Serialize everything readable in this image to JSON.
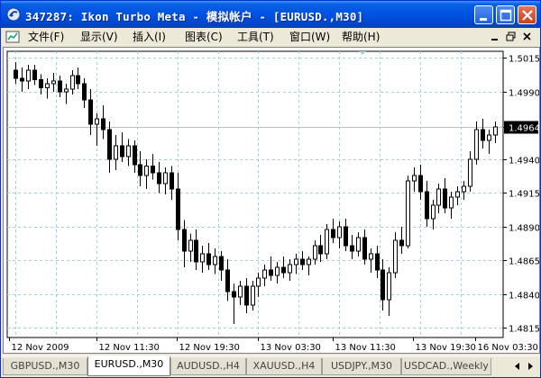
{
  "window": {
    "title": "347287: Ikon Turbo Meta - 模拟帐户 - [EURUSD.,M30]"
  },
  "menu": {
    "items": [
      {
        "name": "menu-file",
        "label": "文件(F)"
      },
      {
        "name": "menu-view",
        "label": "显示(V)"
      },
      {
        "name": "menu-insert",
        "label": "插入(I)"
      },
      {
        "name": "menu-charts",
        "label": "图表(C)"
      },
      {
        "name": "menu-tools",
        "label": "工具(T)"
      },
      {
        "name": "menu-window",
        "label": "窗口(W)"
      },
      {
        "name": "menu-help",
        "label": "帮助(H)"
      }
    ]
  },
  "chart_data": {
    "type": "candlestick",
    "symbol": "EURUSD.",
    "timeframe": "M30",
    "ylim": [
      1.4808,
      1.502
    ],
    "yticks": [
      "1.5015",
      "1.4990",
      "1.4964",
      "1.4940",
      "1.4915",
      "1.4890",
      "1.4865",
      "1.4840",
      "1.4815"
    ],
    "current_price": "1.4964",
    "xticks": [
      "12 Nov 2009",
      "12 Nov 11:30",
      "12 Nov 19:30",
      "13 Nov 03:30",
      "13 Nov 11:30",
      "13 Nov 19:30",
      "16 Nov 03:30"
    ],
    "grid": true,
    "grid_style": "dashed",
    "grid_color": "#9ed3e0",
    "candles": [
      [
        1.5006,
        1.5012,
        1.4996,
        1.5
      ],
      [
        1.5,
        1.5008,
        1.499,
        1.4998
      ],
      [
        1.4998,
        1.501,
        1.4992,
        1.5006
      ],
      [
        1.5006,
        1.501,
        1.4995,
        1.4999
      ],
      [
        1.4999,
        1.5003,
        1.4988,
        1.4993
      ],
      [
        1.4993,
        1.5,
        1.4985,
        1.4996
      ],
      [
        1.4996,
        1.5004,
        1.499,
        1.4998
      ],
      [
        1.4998,
        1.5002,
        1.4986,
        1.499
      ],
      [
        1.499,
        1.4996,
        1.4981,
        1.4992
      ],
      [
        1.4992,
        1.5006,
        1.4988,
        1.5002
      ],
      [
        1.5002,
        1.5008,
        1.4992,
        1.4996
      ],
      [
        1.4996,
        1.5,
        1.4978,
        1.4984
      ],
      [
        1.4984,
        1.4992,
        1.4958,
        1.4966
      ],
      [
        1.4966,
        1.4974,
        1.495,
        1.497
      ],
      [
        1.497,
        1.498,
        1.4955,
        1.4962
      ],
      [
        1.4962,
        1.4968,
        1.493,
        1.494
      ],
      [
        1.494,
        1.4958,
        1.4932,
        1.495
      ],
      [
        1.495,
        1.496,
        1.4938,
        1.4942
      ],
      [
        1.4942,
        1.4955,
        1.4935,
        1.495
      ],
      [
        1.495,
        1.4954,
        1.493,
        1.4936
      ],
      [
        1.4936,
        1.4946,
        1.492,
        1.4928
      ],
      [
        1.4928,
        1.494,
        1.4918,
        1.4935
      ],
      [
        1.4935,
        1.4944,
        1.4925,
        1.493
      ],
      [
        1.493,
        1.4938,
        1.4915,
        1.4922
      ],
      [
        1.4922,
        1.4934,
        1.4914,
        1.493
      ],
      [
        1.493,
        1.4935,
        1.491,
        1.4918
      ],
      [
        1.4918,
        1.493,
        1.488,
        1.4888
      ],
      [
        1.4888,
        1.4895,
        1.486,
        1.4872
      ],
      [
        1.4872,
        1.4885,
        1.4864,
        1.488
      ],
      [
        1.488,
        1.4888,
        1.4858,
        1.4864
      ],
      [
        1.4864,
        1.4876,
        1.4856,
        1.487
      ],
      [
        1.487,
        1.4878,
        1.4858,
        1.4862
      ],
      [
        1.4862,
        1.4874,
        1.4855,
        1.4868
      ],
      [
        1.4868,
        1.4872,
        1.485,
        1.4858
      ],
      [
        1.4858,
        1.4866,
        1.4835,
        1.4842
      ],
      [
        1.4842,
        1.4848,
        1.4818,
        1.4838
      ],
      [
        1.4838,
        1.485,
        1.4832,
        1.4846
      ],
      [
        1.4846,
        1.4852,
        1.4826,
        1.4832
      ],
      [
        1.4832,
        1.485,
        1.4828,
        1.4846
      ],
      [
        1.4846,
        1.4856,
        1.4838,
        1.4852
      ],
      [
        1.4852,
        1.4862,
        1.4846,
        1.4858
      ],
      [
        1.4858,
        1.4868,
        1.485,
        1.4854
      ],
      [
        1.4854,
        1.4864,
        1.4848,
        1.486
      ],
      [
        1.486,
        1.4868,
        1.4852,
        1.4856
      ],
      [
        1.4856,
        1.4866,
        1.485,
        1.4862
      ],
      [
        1.4862,
        1.487,
        1.4855,
        1.4866
      ],
      [
        1.4866,
        1.4872,
        1.4858,
        1.4862
      ],
      [
        1.4862,
        1.4868,
        1.4854,
        1.4866
      ],
      [
        1.4866,
        1.488,
        1.4862,
        1.4876
      ],
      [
        1.4876,
        1.4884,
        1.4864,
        1.487
      ],
      [
        1.487,
        1.4892,
        1.4866,
        1.4888
      ],
      [
        1.4888,
        1.4896,
        1.4878,
        1.4882
      ],
      [
        1.4882,
        1.4894,
        1.4874,
        1.489
      ],
      [
        1.489,
        1.4896,
        1.4872,
        1.4876
      ],
      [
        1.4876,
        1.4884,
        1.4866,
        1.4872
      ],
      [
        1.4872,
        1.4886,
        1.4868,
        1.4882
      ],
      [
        1.4882,
        1.4888,
        1.4862,
        1.4866
      ],
      [
        1.4866,
        1.4874,
        1.4856,
        1.487
      ],
      [
        1.487,
        1.4876,
        1.4852,
        1.4858
      ],
      [
        1.4858,
        1.4866,
        1.4828,
        1.4836
      ],
      [
        1.4836,
        1.486,
        1.4824,
        1.4856
      ],
      [
        1.4856,
        1.4886,
        1.4852,
        1.488
      ],
      [
        1.488,
        1.489,
        1.487,
        1.4876
      ],
      [
        1.4876,
        1.4928,
        1.4874,
        1.4924
      ],
      [
        1.4924,
        1.4934,
        1.4916,
        1.4928
      ],
      [
        1.4928,
        1.4936,
        1.491,
        1.4916
      ],
      [
        1.4916,
        1.4924,
        1.489,
        1.4896
      ],
      [
        1.4896,
        1.491,
        1.4888,
        1.4906
      ],
      [
        1.4906,
        1.4922,
        1.49,
        1.4918
      ],
      [
        1.4918,
        1.4926,
        1.49,
        1.4904
      ],
      [
        1.4904,
        1.4916,
        1.4896,
        1.4912
      ],
      [
        1.4912,
        1.492,
        1.4906,
        1.4916
      ],
      [
        1.4916,
        1.4924,
        1.491,
        1.492
      ],
      [
        1.492,
        1.4946,
        1.4916,
        1.494
      ],
      [
        1.494,
        1.4968,
        1.4936,
        1.4962
      ],
      [
        1.4962,
        1.497,
        1.4948,
        1.4954
      ],
      [
        1.4954,
        1.4962,
        1.4944,
        1.4958
      ],
      [
        1.4958,
        1.4968,
        1.4952,
        1.4964
      ]
    ]
  },
  "tabs": [
    {
      "name": "tab-gbpusd-m30",
      "label": "GBPUSD.,M30",
      "active": false
    },
    {
      "name": "tab-eurusd-m30",
      "label": "EURUSD.,M30",
      "active": true
    },
    {
      "name": "tab-audusd-h4",
      "label": "AUDUSD.,H4",
      "active": false
    },
    {
      "name": "tab-xauusd-h4",
      "label": "XAUUSD.,H4",
      "active": false
    },
    {
      "name": "tab-usdjpy-m30",
      "label": "USDJPY.,M30",
      "active": false
    },
    {
      "name": "tab-usdcad-weekly",
      "label": "USDCAD.,Weekly",
      "active": false
    }
  ],
  "colors": {
    "titlebar": "#0054e3",
    "candle": "#000000",
    "grid": "#9ed3e0",
    "chart_bg": "#ffffff"
  }
}
